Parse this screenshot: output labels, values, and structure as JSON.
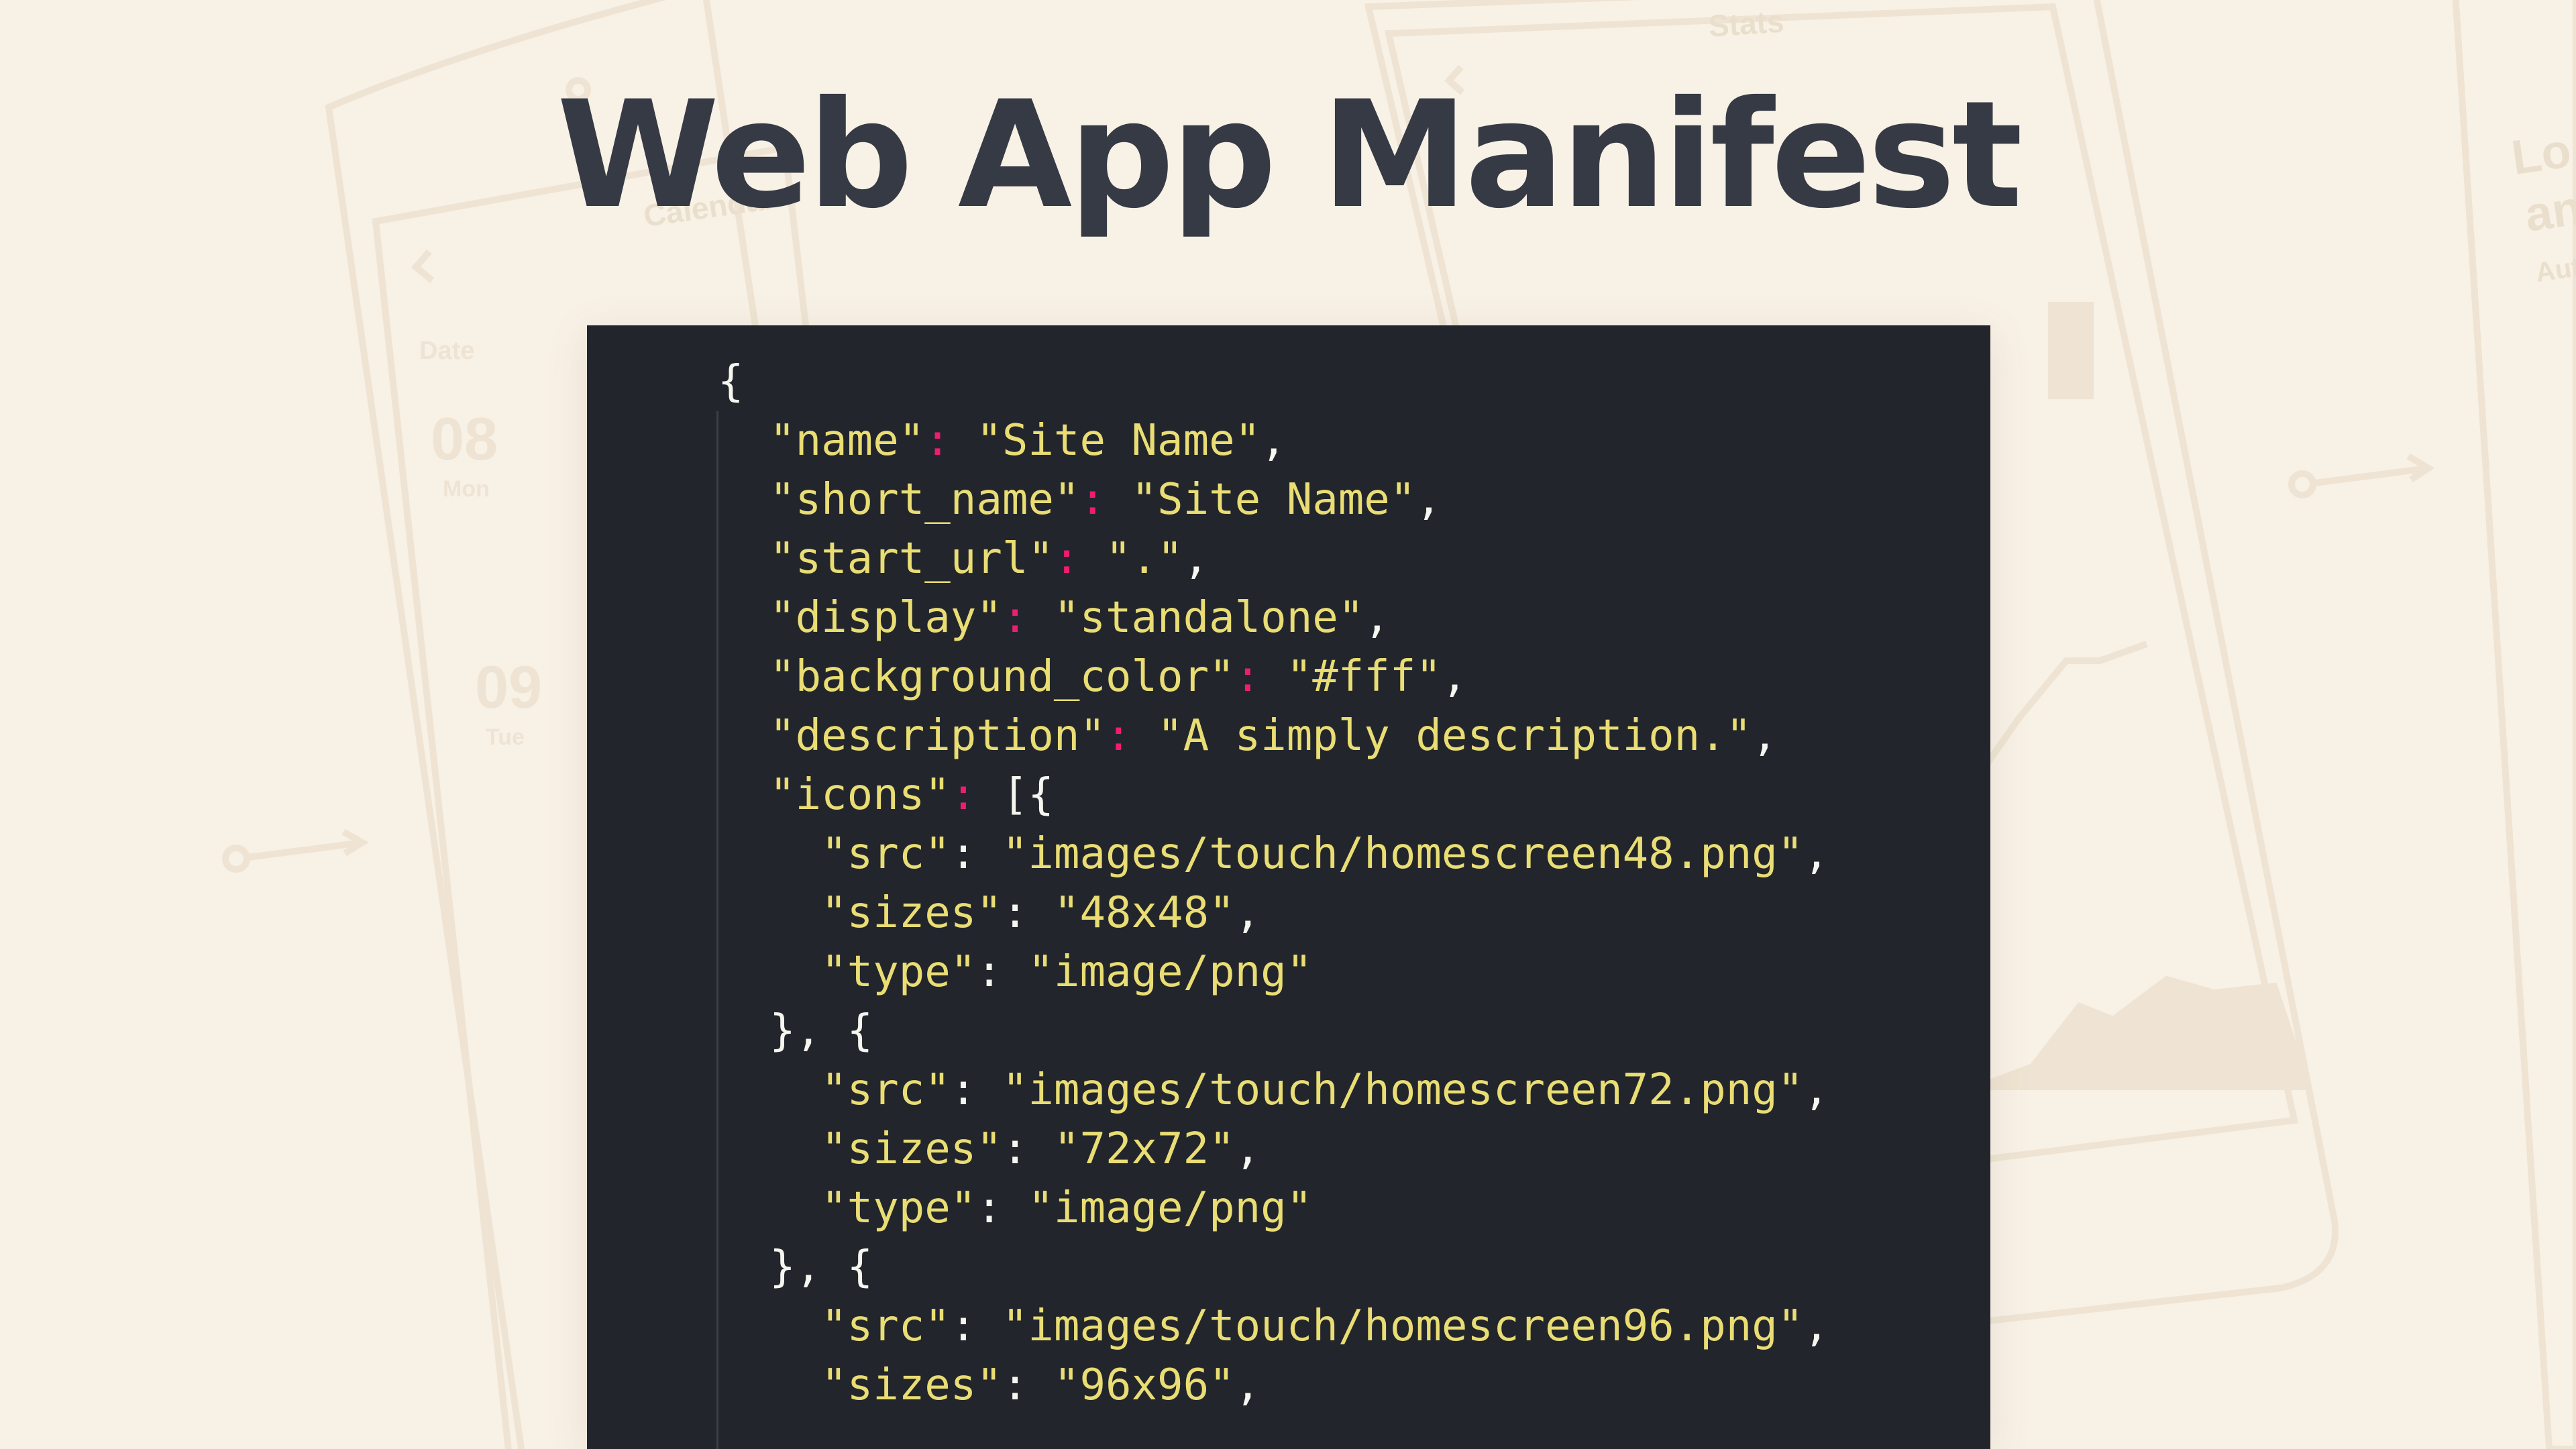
{
  "page": {
    "title": "Web App Manifest",
    "colors": {
      "background": "#f8f1e6",
      "title": "#363a45",
      "code_background": "#22262c",
      "code_string": "#e9dd74",
      "code_colon": "#f01c70",
      "code_plain": "#f6f6f0"
    }
  },
  "background_art": {
    "screen_titles": [
      "Calendar",
      "Stats"
    ],
    "calendar_days": [
      "08",
      "09"
    ],
    "calendar_day_names": [
      "Mon",
      "Tue"
    ],
    "calendar_label": "Date",
    "partial_texts": [
      "Lo",
      "an",
      "Aut"
    ]
  },
  "code": {
    "lines": [
      {
        "indent": "",
        "parts": [
          {
            "t": "{",
            "c": "p"
          }
        ]
      },
      {
        "indent": "  ",
        "parts": [
          {
            "t": "\"name\"",
            "c": "k"
          },
          {
            "t": ":",
            "c": "c"
          },
          {
            "t": " ",
            "c": "p"
          },
          {
            "t": "\"Site Name\"",
            "c": "s"
          },
          {
            "t": ",",
            "c": "p"
          }
        ]
      },
      {
        "indent": "  ",
        "parts": [
          {
            "t": "\"short_name\"",
            "c": "k"
          },
          {
            "t": ":",
            "c": "c"
          },
          {
            "t": " ",
            "c": "p"
          },
          {
            "t": "\"Site Name\"",
            "c": "s"
          },
          {
            "t": ",",
            "c": "p"
          }
        ]
      },
      {
        "indent": "  ",
        "parts": [
          {
            "t": "\"start_url\"",
            "c": "k"
          },
          {
            "t": ":",
            "c": "c"
          },
          {
            "t": " ",
            "c": "p"
          },
          {
            "t": "\".\"",
            "c": "s"
          },
          {
            "t": ",",
            "c": "p"
          }
        ]
      },
      {
        "indent": "  ",
        "parts": [
          {
            "t": "\"display\"",
            "c": "k"
          },
          {
            "t": ":",
            "c": "c"
          },
          {
            "t": " ",
            "c": "p"
          },
          {
            "t": "\"standalone\"",
            "c": "s"
          },
          {
            "t": ",",
            "c": "p"
          }
        ]
      },
      {
        "indent": "  ",
        "parts": [
          {
            "t": "\"background_color\"",
            "c": "k"
          },
          {
            "t": ":",
            "c": "c"
          },
          {
            "t": " ",
            "c": "p"
          },
          {
            "t": "\"#fff\"",
            "c": "s"
          },
          {
            "t": ",",
            "c": "p"
          }
        ]
      },
      {
        "indent": "  ",
        "parts": [
          {
            "t": "\"description\"",
            "c": "k"
          },
          {
            "t": ":",
            "c": "c"
          },
          {
            "t": " ",
            "c": "p"
          },
          {
            "t": "\"A simply description.\"",
            "c": "s"
          },
          {
            "t": ",",
            "c": "p"
          }
        ]
      },
      {
        "indent": "  ",
        "parts": [
          {
            "t": "\"icons\"",
            "c": "k"
          },
          {
            "t": ":",
            "c": "c"
          },
          {
            "t": " [{",
            "c": "p"
          }
        ]
      },
      {
        "indent": "    ",
        "parts": [
          {
            "t": "\"src\"",
            "c": "k"
          },
          {
            "t": ": ",
            "c": "p"
          },
          {
            "t": "\"images/touch/homescreen48.png\"",
            "c": "s"
          },
          {
            "t": ",",
            "c": "p"
          }
        ]
      },
      {
        "indent": "    ",
        "parts": [
          {
            "t": "\"sizes\"",
            "c": "k"
          },
          {
            "t": ": ",
            "c": "p"
          },
          {
            "t": "\"48x48\"",
            "c": "s"
          },
          {
            "t": ",",
            "c": "p"
          }
        ]
      },
      {
        "indent": "    ",
        "parts": [
          {
            "t": "\"type\"",
            "c": "k"
          },
          {
            "t": ": ",
            "c": "p"
          },
          {
            "t": "\"image/png\"",
            "c": "s"
          }
        ]
      },
      {
        "indent": "  ",
        "parts": [
          {
            "t": "}, {",
            "c": "p"
          }
        ]
      },
      {
        "indent": "    ",
        "parts": [
          {
            "t": "\"src\"",
            "c": "k"
          },
          {
            "t": ": ",
            "c": "p"
          },
          {
            "t": "\"images/touch/homescreen72.png\"",
            "c": "s"
          },
          {
            "t": ",",
            "c": "p"
          }
        ]
      },
      {
        "indent": "    ",
        "parts": [
          {
            "t": "\"sizes\"",
            "c": "k"
          },
          {
            "t": ": ",
            "c": "p"
          },
          {
            "t": "\"72x72\"",
            "c": "s"
          },
          {
            "t": ",",
            "c": "p"
          }
        ]
      },
      {
        "indent": "    ",
        "parts": [
          {
            "t": "\"type\"",
            "c": "k"
          },
          {
            "t": ": ",
            "c": "p"
          },
          {
            "t": "\"image/png\"",
            "c": "s"
          }
        ]
      },
      {
        "indent": "  ",
        "parts": [
          {
            "t": "}, {",
            "c": "p"
          }
        ]
      },
      {
        "indent": "    ",
        "parts": [
          {
            "t": "\"src\"",
            "c": "k"
          },
          {
            "t": ": ",
            "c": "p"
          },
          {
            "t": "\"images/touch/homescreen96.png\"",
            "c": "s"
          },
          {
            "t": ",",
            "c": "p"
          }
        ]
      },
      {
        "indent": "    ",
        "parts": [
          {
            "t": "\"sizes\"",
            "c": "k"
          },
          {
            "t": ": ",
            "c": "p"
          },
          {
            "t": "\"96x96\"",
            "c": "s"
          },
          {
            "t": ",",
            "c": "p"
          }
        ]
      }
    ]
  }
}
